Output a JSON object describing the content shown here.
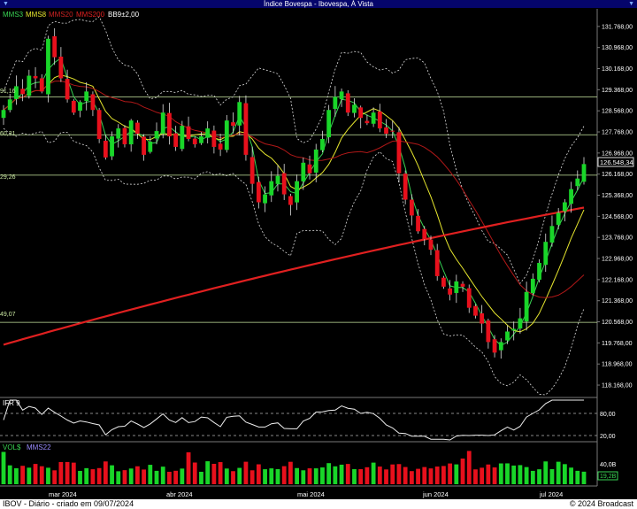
{
  "window": {
    "title": "Índice Bovespa - Ibovespa, À Vista"
  },
  "legend": [
    {
      "label": "MMS3",
      "color": "#39d353"
    },
    {
      "label": "MMS8",
      "color": "#e6e62e"
    },
    {
      "label": "MMS20",
      "color": "#cc2222"
    },
    {
      "label": "MMS200",
      "color": "#e02020"
    },
    {
      "label": "BB9±2,00",
      "color": "#ffffff"
    }
  ],
  "hlines": [
    "91,16",
    "60,31",
    "29,26",
    "49,07"
  ],
  "ifr_panel": {
    "label": "IFR 9",
    "ticks": [
      "80,00",
      "20,00"
    ]
  },
  "vol_panel": {
    "label": "VOL$",
    "ma_label": "MMS22",
    "tick": "40,0B",
    "last_value": "19,2B"
  },
  "price_label": "126.548,34",
  "footer": {
    "left": "IBOV - Diário - criado em 09/07/2024",
    "right": "© 2024 Broadcast"
  },
  "chart_data": {
    "type": "candlestick",
    "title": "Índice Bovespa - Ibovespa, À Vista",
    "y_ticks": [
      "131.768,00",
      "130.968,00",
      "130.168,00",
      "129.368,00",
      "128.568,00",
      "127.768,00",
      "126.968,00",
      "126.168,00",
      "125.368,00",
      "124.568,00",
      "123.768,00",
      "122.968,00",
      "122.168,00",
      "121.368,00",
      "120.568,00",
      "119.768,00",
      "118.968,00",
      "118.168,00"
    ],
    "ylim": [
      117800,
      132300
    ],
    "x_labels": [
      "mar 2024",
      "abr 2024",
      "mai 2024",
      "jun 2024",
      "jul 2024"
    ],
    "horizontal_lines": [
      129091.16,
      127660.31,
      126129.26,
      120549.07
    ],
    "last_price": 126548.34,
    "closes": [
      128600,
      129000,
      129500,
      129200,
      129900,
      129800,
      129300,
      131300,
      130600,
      129800,
      129000,
      128500,
      128900,
      129300,
      128600,
      127500,
      126800,
      127600,
      127900,
      127300,
      128200,
      127700,
      126900,
      127400,
      127800,
      128500,
      127600,
      127200,
      128000,
      127500,
      127300,
      127600,
      127900,
      127200,
      127100,
      128200,
      128000,
      128900,
      126900,
      125800,
      125100,
      125400,
      125900,
      126100,
      125400,
      125000,
      125900,
      126600,
      126200,
      127100,
      127500,
      128600,
      129100,
      129300,
      128500,
      128800,
      128300,
      128100,
      128500,
      127900,
      127700,
      127800,
      126200,
      125200,
      124600,
      124000,
      123700,
      123300,
      122300,
      121900,
      121600,
      122100,
      121900,
      121100,
      120800,
      120500,
      119800,
      119400,
      119800,
      120200,
      120300,
      120700,
      121700,
      122200,
      122800,
      123600,
      124200,
      124700,
      125100,
      125600,
      126000,
      126548.34
    ]
  }
}
